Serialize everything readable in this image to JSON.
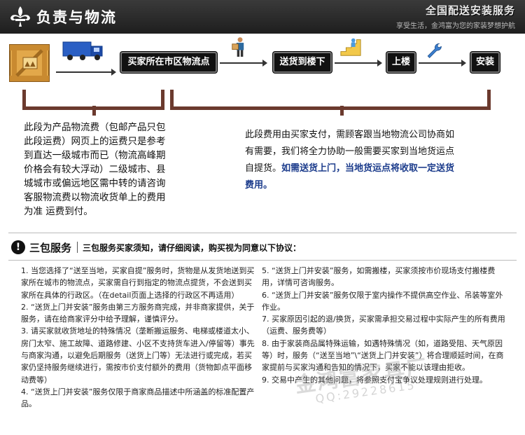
{
  "header": {
    "title": "负责与物流",
    "slogan": "全国配送安装服务",
    "subslogan": "享受生活，金鸿富为您的家装梦想护航"
  },
  "flow": {
    "steps": [
      "买家所在市区物流点",
      "送货到楼下",
      "上楼",
      "安装"
    ],
    "icons": [
      "wooden-crate-icon",
      "truck-icon",
      "delivery-man-icon",
      "stairs-icon",
      "wrench-icon"
    ]
  },
  "notes": {
    "left": "此段为产品物流费（包邮产品只包此段运费）网页上的运费只是参考到直达一级城市而已（物流高峰期价格会有较大浮动）二级城市、县城城市或偏远地区需中转的请咨询客服物流费以物流收货单上的费用为准 运费到付。",
    "right_plain": "此段费用由买家支付，需顾客跟当地物流公司协商如有需要，我们将全力协助一般需要买家到当地货运点自提货。",
    "right_highlight": "如需送货上门，当地货运点将收取一定送货费用。"
  },
  "guarantee": {
    "title": "三包服务",
    "desc": "三包服务买家须知，请仔细阅读，购买视为同意以下协议："
  },
  "terms_left": [
    "1. 当您选择了“送至当地，买家自提”服务时，货物是从发货地送到买家所在城市的物流点，买家需自行到指定的物流点提货，不会送到买家所在具体的行政区。（在detail页面上选择的行政区不再适用）",
    "2. “送货上门并安装”服务由第三方服务商完成，并非商家提供，关于服务，请在给商家评分中给予理解，谨慎评分。",
    "3. 请买家就收货地址的特殊情况（垄断搬运服务、电梯或楼道太小、房门太窄、施工故障、道路修建、小区不支持货车进入/停留等）事先与商家沟通，以避免后期服务（送货上门等）无法进行或完成，若买家仍坚持服务继续进行，需按市价支付额外的费用（货物卸点平面移动费等）",
    "4. “送货上门并安装”服务仅限于商家商品描述中所涵盖的标准配置产品。"
  ],
  "terms_right": [
    "5. “送货上门并安装”服务，如需搬楼，买家须按市价现场支付搬楼费用，详情可咨询服务。",
    "6. “送货上门并安装”服务仅限于室内操作不提供高空作业、吊装等室外作业。",
    "7. 买家原因引起的退/换货，买家需承担交易过程中实际产生的所有费用（运费、服务费等）",
    "8. 由于家装商品属特殊运输，如遇特殊情况（如，道路受阻、天气原因等）时，服务（“送至当地”\\“送货上门并安装”）将合理顺延时间，在商家提前与买家沟通和告知的情况下，买家不能以该理由拒收。",
    "9. 交易中产生的其他问题，将参照支付宝争议处理规则进行处理。"
  ],
  "watermark": {
    "text": "金鸿富家具厂",
    "number": "QQ:29228615"
  }
}
